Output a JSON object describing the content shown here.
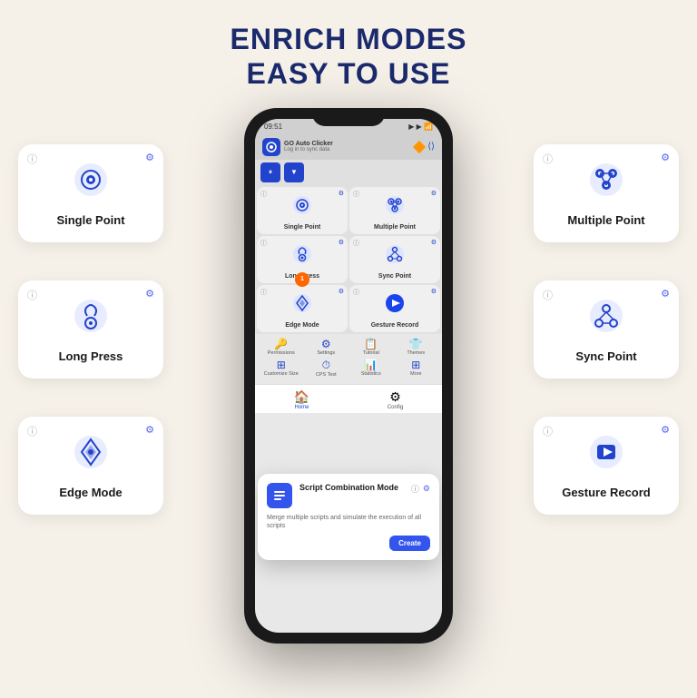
{
  "header": {
    "title_line1": "ENRICH MODES",
    "title_line2": "EASY TO USE"
  },
  "phone": {
    "status_time": "09:51",
    "app_name": "GO Auto Clicker",
    "app_sub": "Log in to sync data",
    "grid": [
      {
        "label": "Single Point",
        "icon": "🎯"
      },
      {
        "label": "Multiple Point",
        "icon": "🎯"
      },
      {
        "label": "Long Press",
        "icon": "👆"
      },
      {
        "label": "Sync Point",
        "icon": "⚙"
      },
      {
        "label": "Edge Mode",
        "icon": "✦"
      },
      {
        "label": "Gesture Record",
        "icon": "🎥"
      }
    ],
    "bottom_nav": [
      {
        "label": "Permissions",
        "icon": "🔑"
      },
      {
        "label": "Settings",
        "icon": "⚙"
      },
      {
        "label": "Tutorial",
        "icon": "📋"
      },
      {
        "label": "Themes",
        "icon": "👕"
      },
      {
        "label": "Customize Size",
        "icon": "⊞"
      },
      {
        "label": "CPS Test",
        "icon": "⏱"
      },
      {
        "label": "Statistics",
        "icon": "📊"
      },
      {
        "label": "More",
        "icon": "⊞"
      }
    ],
    "tabs": [
      {
        "label": "Home",
        "active": true
      },
      {
        "label": "Config",
        "active": false
      }
    ],
    "script_popup": {
      "title": "Script Combination Mode",
      "desc": "Merge multiple scripts and simulate the execution of all scripts",
      "create_label": "Create"
    }
  },
  "left_cards": [
    {
      "id": "single-point",
      "label": "Single Point"
    },
    {
      "id": "long-press",
      "label": "Long Press"
    },
    {
      "id": "edge-mode",
      "label": "Edge Mode"
    }
  ],
  "right_cards": [
    {
      "id": "multiple-point",
      "label": "Multiple Point"
    },
    {
      "id": "sync-point",
      "label": "Sync Point"
    },
    {
      "id": "gesture-record",
      "label": "Gesture Record"
    }
  ]
}
